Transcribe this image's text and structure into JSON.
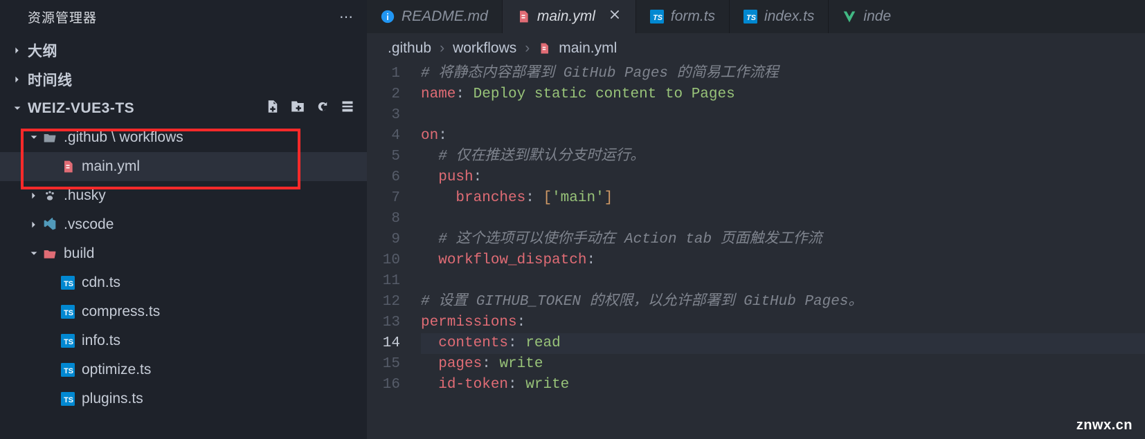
{
  "sidebar": {
    "title": "资源管理器",
    "sections": {
      "outline": "大纲",
      "timeline": "时间线",
      "project": "WEIZ-VUE3-TS"
    },
    "tree": {
      "github": ".github \\ workflows",
      "mainyml": "main.yml",
      "husky": ".husky",
      "vscode": ".vscode",
      "build": "build",
      "cdn": "cdn.ts",
      "compress": "compress.ts",
      "info": "info.ts",
      "optimize": "optimize.ts",
      "plugins": "plugins.ts"
    }
  },
  "tabs": [
    {
      "label": "README.md",
      "icon": "info",
      "active": false
    },
    {
      "label": "main.yml",
      "icon": "yaml",
      "active": true
    },
    {
      "label": "form.ts",
      "icon": "ts",
      "active": false
    },
    {
      "label": "index.ts",
      "icon": "ts",
      "active": false
    },
    {
      "label": "inde",
      "icon": "vue",
      "active": false
    }
  ],
  "breadcrumb": {
    "seg1": ".github",
    "seg2": "workflows",
    "seg3": "main.yml"
  },
  "editor": {
    "active_line": 14,
    "lines": [
      {
        "n": 1,
        "t": "comment",
        "text": "# 将静态内容部署到 GitHub Pages 的简易工作流程"
      },
      {
        "n": 2,
        "t": "kv",
        "key": "name",
        "val": "Deploy static content to Pages"
      },
      {
        "n": 3,
        "t": "blank"
      },
      {
        "n": 4,
        "t": "key",
        "key": "on"
      },
      {
        "n": 5,
        "t": "comment_i",
        "text": "# 仅在推送到默认分支时运行。"
      },
      {
        "n": 6,
        "t": "key_i",
        "key": "push"
      },
      {
        "n": 7,
        "t": "branches",
        "key": "branches",
        "val": "'main'"
      },
      {
        "n": 8,
        "t": "blank"
      },
      {
        "n": 9,
        "t": "comment_i",
        "text": "# 这个选项可以使你手动在 Action tab 页面触发工作流"
      },
      {
        "n": 10,
        "t": "key_i",
        "key": "workflow_dispatch"
      },
      {
        "n": 11,
        "t": "blank"
      },
      {
        "n": 12,
        "t": "comment",
        "text": "# 设置 GITHUB_TOKEN 的权限，以允许部署到 GitHub Pages。"
      },
      {
        "n": 13,
        "t": "key",
        "key": "permissions"
      },
      {
        "n": 14,
        "t": "kv_i",
        "key": "contents",
        "val": "read"
      },
      {
        "n": 15,
        "t": "kv_i",
        "key": "pages",
        "val": "write"
      },
      {
        "n": 16,
        "t": "kv_i",
        "key": "id-token",
        "val": "write"
      }
    ]
  },
  "watermark": "znwx.cn"
}
